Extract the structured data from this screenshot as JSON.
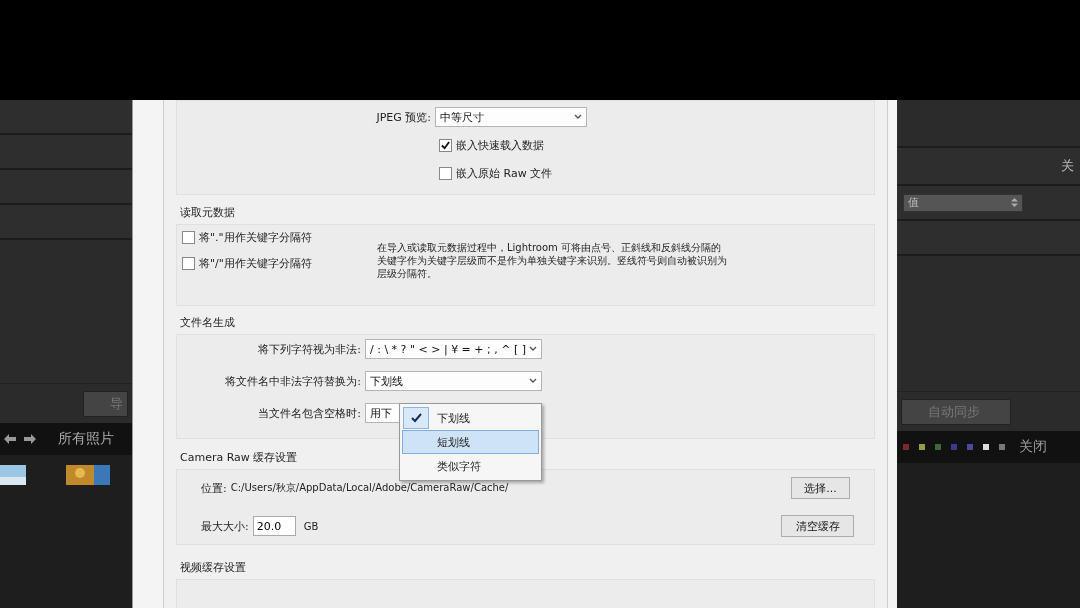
{
  "left_panel": {
    "button": "导",
    "source_label": "所有照片"
  },
  "right_panel": {
    "heading": "关",
    "select_value": "值",
    "button": "自动同步",
    "filter_label": "关闭"
  },
  "dialog": {
    "preview": {
      "label": "JPEG 预览:",
      "value": "中等尺寸",
      "options": [
        {
          "label": "嵌入快速载入数据",
          "checked": true
        },
        {
          "label": "嵌入原始 Raw 文件",
          "checked": false
        }
      ]
    },
    "read_metadata": {
      "title": "读取元数据",
      "options": [
        {
          "label": "将\".\"用作关键字分隔符",
          "checked": false
        },
        {
          "label": "将\"/\"用作关键字分隔符",
          "checked": false
        }
      ],
      "description": "在导入或读取元数据过程中，Lightroom 可将由点号、正斜线和反斜线分隔的关键字作为关键字层级而不是作为单独关键字来识别。竖线符号则自动被识别为层级分隔符。"
    },
    "file_naming": {
      "title": "文件名生成",
      "rows": [
        {
          "label": "将下列字符视为非法:",
          "value": "/ : \\ * ? \" < > | ¥ = + ; , ^ [ ]"
        },
        {
          "label": "将文件名中非法字符替换为:",
          "value": "下划线"
        },
        {
          "label": "当文件名包含空格时:",
          "value": "用下"
        }
      ],
      "menu": [
        {
          "label": "下划线",
          "selected": true,
          "highlighted": false
        },
        {
          "label": "短划线",
          "selected": false,
          "highlighted": true
        },
        {
          "label": "类似字符",
          "selected": false,
          "highlighted": false
        }
      ]
    },
    "camera_raw": {
      "title": "Camera Raw 缓存设置",
      "location_label": "位置:",
      "location": "C:/Users/秋京/AppData/Local/Adobe/CameraRaw/Cache/",
      "choose_button": "选择...",
      "size_label": "最大大小:",
      "size_value": "20.0",
      "size_unit": "GB",
      "purge_button": "清空缓存"
    },
    "video_cache": {
      "title": "视频缓存设置"
    }
  }
}
